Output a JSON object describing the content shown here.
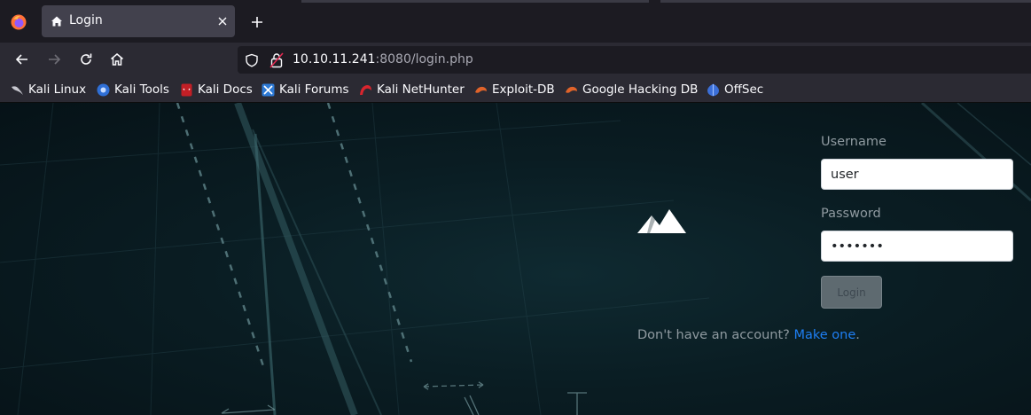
{
  "browser": {
    "tab": {
      "title": "Login"
    },
    "url": {
      "host": "10.10.11.241",
      "rest": ":8080/login.php"
    },
    "bookmarks": [
      {
        "label": "Kali Linux",
        "icon": "kali-dragon-icon"
      },
      {
        "label": "Kali Tools",
        "icon": "kali-tools-icon"
      },
      {
        "label": "Kali Docs",
        "icon": "kali-docs-icon"
      },
      {
        "label": "Kali Forums",
        "icon": "kali-forums-icon"
      },
      {
        "label": "Kali NetHunter",
        "icon": "kali-nethunter-icon"
      },
      {
        "label": "Exploit-DB",
        "icon": "exploit-db-icon"
      },
      {
        "label": "Google Hacking DB",
        "icon": "ghdb-icon"
      },
      {
        "label": "OffSec",
        "icon": "offsec-icon"
      }
    ]
  },
  "login": {
    "username_label": "Username",
    "username_value": "user",
    "password_label": "Password",
    "password_value": "1234567",
    "button_label": "Login",
    "signup_text": "Don't have an account?",
    "signup_link": "Make one",
    "signup_suffix": "."
  },
  "colors": {
    "link": "#1e7ef2",
    "page_bg": "#0a1d23",
    "chrome_bg": "#2b2a33"
  }
}
